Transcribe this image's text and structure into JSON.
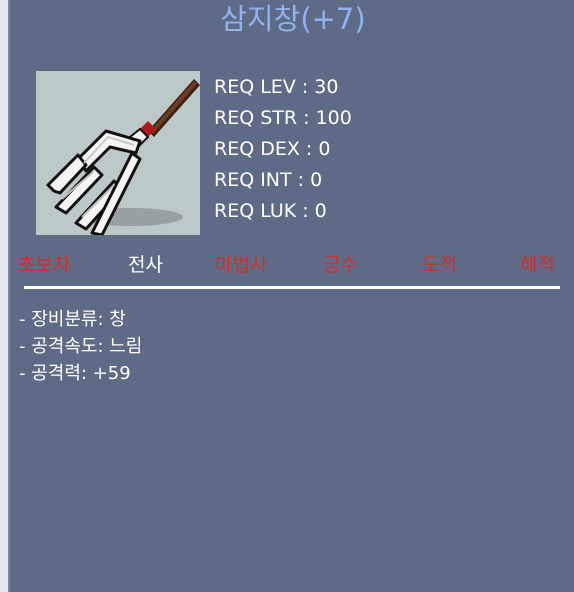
{
  "item": {
    "name": "삼지창(+7)",
    "icon": "trident-icon"
  },
  "requirements": [
    {
      "label": "REQ LEV : 30"
    },
    {
      "label": "REQ STR : 100"
    },
    {
      "label": "REQ DEX : 0"
    },
    {
      "label": "REQ INT : 0"
    },
    {
      "label": "REQ LUK : 0"
    }
  ],
  "jobs": [
    {
      "label": "초보자",
      "usable": false
    },
    {
      "label": "전사",
      "usable": true
    },
    {
      "label": "마법사",
      "usable": false
    },
    {
      "label": "궁수",
      "usable": false
    },
    {
      "label": "도적",
      "usable": false
    },
    {
      "label": "해적",
      "usable": false
    }
  ],
  "stats": [
    {
      "text": "- 장비분류: 창"
    },
    {
      "text": "- 공격속도: 느림"
    },
    {
      "text": "- 공격력: +59"
    }
  ],
  "colors": {
    "panel_bg": "#5f6a86",
    "title": "#8fb3ee",
    "text": "#ffffff",
    "job_disabled": "#d42d2a"
  }
}
